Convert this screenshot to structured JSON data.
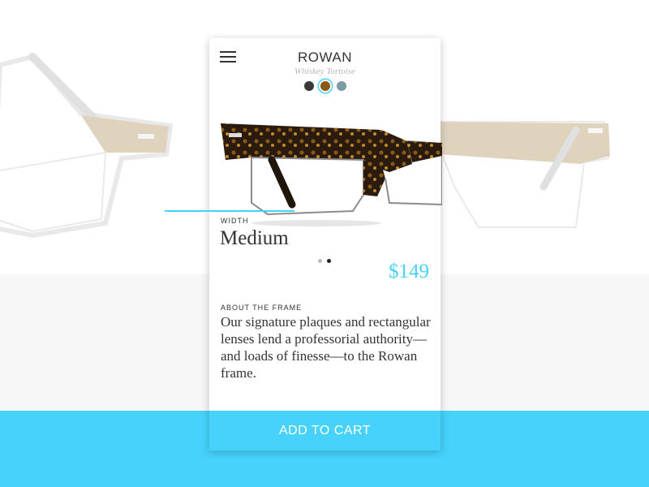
{
  "product": {
    "name": "ROWAN",
    "color_name": "Whiskey Tortoise",
    "swatches": [
      {
        "name": "dark",
        "color": "#3a3a3a"
      },
      {
        "name": "whiskey-tortoise",
        "color": "#8b5a12",
        "selected": true
      },
      {
        "name": "blue-gray",
        "color": "#7a9aa4"
      }
    ],
    "width_label": "WIDTH",
    "width_value": "Medium",
    "price": "$149",
    "carousel_dots": 2,
    "carousel_active_index": 1
  },
  "about": {
    "label": "ABOUT THE FRAME",
    "text": "Our signature plaques and rectangular lenses lend a professorial authority—and loads of finesse—to the Rowan frame."
  },
  "actions": {
    "add_to_cart_label": "ADD TO CART"
  },
  "colors": {
    "accent": "#46d2fb",
    "text": "#333333",
    "muted": "#b8b8b8",
    "band": "#f7f7f7"
  }
}
